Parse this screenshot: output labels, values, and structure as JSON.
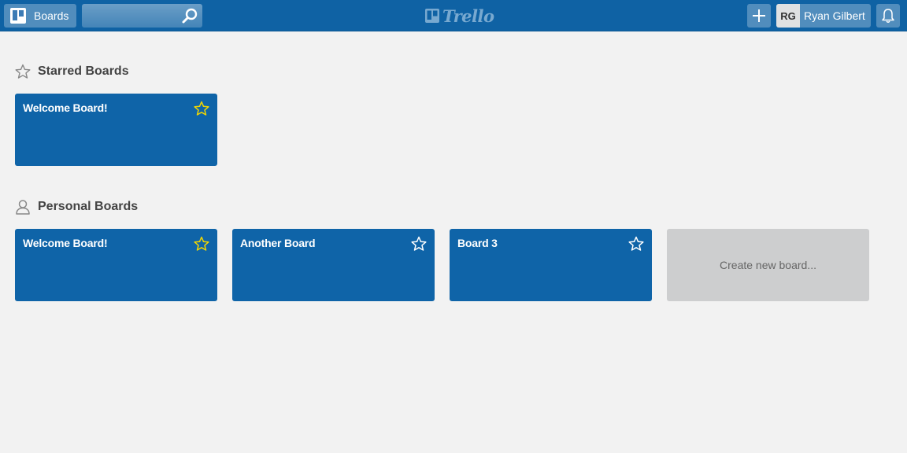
{
  "header": {
    "boards_label": "Boards",
    "search_value": "",
    "logo_text": "Trello",
    "user_initials": "RG",
    "user_name": "Ryan Gilbert",
    "icons": [
      "boards-icon",
      "search-icon",
      "trello-logo-icon",
      "plus-icon",
      "bell-icon"
    ]
  },
  "starred": {
    "title": "Starred Boards",
    "icon": "star-outline-icon",
    "boards": [
      {
        "name": "Welcome Board!",
        "starred": true
      }
    ]
  },
  "personal": {
    "title": "Personal Boards",
    "icon": "person-icon",
    "boards": [
      {
        "name": "Welcome Board!",
        "starred": true
      },
      {
        "name": "Another Board",
        "starred": false
      },
      {
        "name": "Board 3",
        "starred": false
      }
    ],
    "create_label": "Create new board..."
  },
  "colors": {
    "header": "#0f62a4",
    "tile": "#0f64a8",
    "starred_star": "#f2d600",
    "background": "#f2f2f2"
  }
}
